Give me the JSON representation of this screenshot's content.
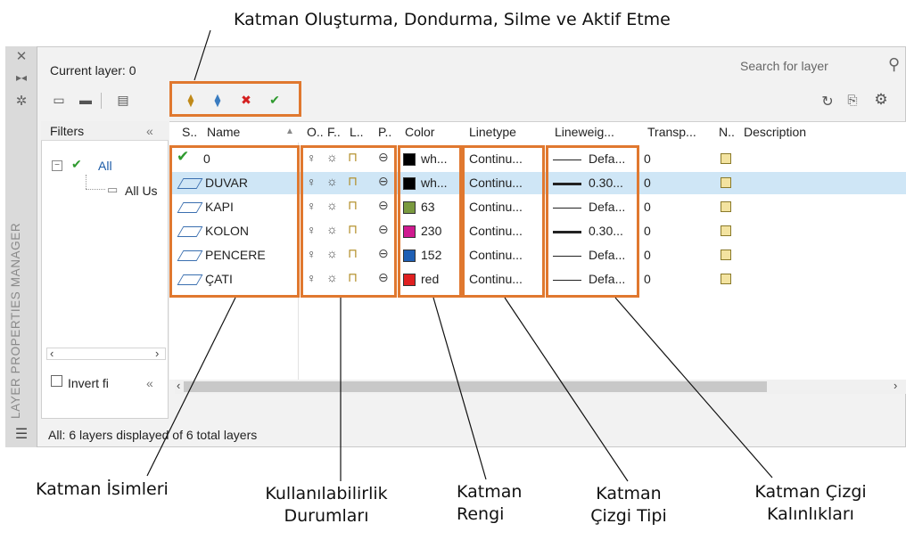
{
  "annotations": {
    "top": "Katman Oluşturma, Dondurma, Silme ve Aktif Etme",
    "names": "Katman İsimleri",
    "availability": [
      "Kullanılabilirlik",
      "Durumları"
    ],
    "color": [
      "Katman",
      "Rengi"
    ],
    "linetype": [
      "Katman",
      "Çizgi Tipi"
    ],
    "lineweight": [
      "Katman Çizgi",
      "Kalınlıkları"
    ]
  },
  "palette": {
    "title": "LAYER PROPERTIES MANAGER",
    "current_layer": "Current layer: 0",
    "search_placeholder": "Search for layer",
    "filters": {
      "header": "Filters",
      "tree": [
        "All",
        "All Us"
      ],
      "invert_label": "Invert fi"
    },
    "columns": [
      "S..",
      "Name",
      "O..",
      "F..",
      "L..",
      "P..",
      "Color",
      "Linetype",
      "Lineweig...",
      "Transp...",
      "N..",
      "Description"
    ],
    "layers": [
      {
        "name": "0",
        "color_name": "wh...",
        "color_hex": "#000000",
        "linetype": "Continu...",
        "lineweight": "Defa...",
        "lw_style": "thin",
        "transparency": "0",
        "current": true,
        "selected": false
      },
      {
        "name": "DUVAR",
        "color_name": "wh...",
        "color_hex": "#000000",
        "linetype": "Continu...",
        "lineweight": "0.30...",
        "lw_style": "thick",
        "transparency": "0",
        "current": false,
        "selected": true
      },
      {
        "name": "KAPI",
        "color_name": "63",
        "color_hex": "#7a9a3f",
        "linetype": "Continu...",
        "lineweight": "Defa...",
        "lw_style": "thin",
        "transparency": "0",
        "current": false,
        "selected": false
      },
      {
        "name": "KOLON",
        "color_name": "230",
        "color_hex": "#cf1a8f",
        "linetype": "Continu...",
        "lineweight": "0.30...",
        "lw_style": "thick",
        "transparency": "0",
        "current": false,
        "selected": false
      },
      {
        "name": "PENCERE",
        "color_name": "152",
        "color_hex": "#1f5fb4",
        "linetype": "Continu...",
        "lineweight": "Defa...",
        "lw_style": "thin",
        "transparency": "0",
        "current": false,
        "selected": false
      },
      {
        "name": "ÇATI",
        "color_name": "red",
        "color_hex": "#e02020",
        "linetype": "Continu...",
        "lineweight": "Defa...",
        "lw_style": "thin",
        "transparency": "0",
        "current": false,
        "selected": false
      }
    ],
    "status": "All: 6 layers displayed of 6 total layers",
    "accent": "#e0782f"
  }
}
